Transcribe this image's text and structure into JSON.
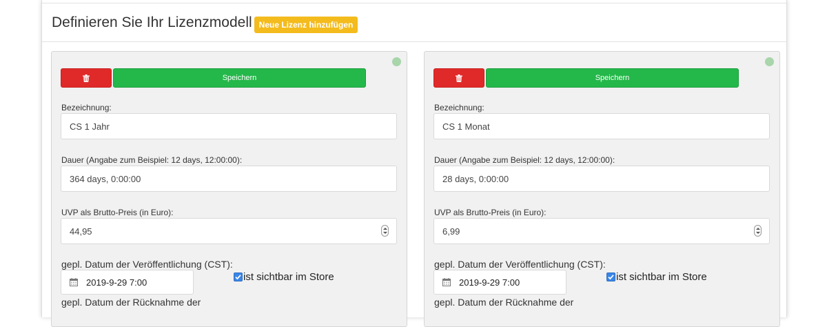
{
  "header": {
    "title": "Definieren Sie Ihr Lizenzmodell",
    "add_button": "Neue Lizenz hinzufügen"
  },
  "colors": {
    "accent_yellow": "#f4bb1c",
    "delete_red": "#e02a2a",
    "save_green": "#24b84a",
    "status_green": "#a8d5aa"
  },
  "licenses": [
    {
      "save_label": "Speichern",
      "name_label": "Bezeichnung:",
      "name_value": "CS 1 Jahr",
      "duration_label": "Dauer (Angabe zum Beispiel: 12 days, 12:00:00):",
      "duration_value": "364 days, 0:00:00",
      "price_label": "UVP als Brutto-Preis (in Euro):",
      "price_value": "44,95",
      "publish_label": "gepl. Datum der Veröffentlichung (CST):",
      "publish_value": "2019-9-29 7:00",
      "visible_label": "ist sichtbar im Store",
      "withdraw_label": "gepl. Datum der Rücknahme der"
    },
    {
      "save_label": "Speichern",
      "name_label": "Bezeichnung:",
      "name_value": "CS 1 Monat",
      "duration_label": "Dauer (Angabe zum Beispiel: 12 days, 12:00:00):",
      "duration_value": "28 days, 0:00:00",
      "price_label": "UVP als Brutto-Preis (in Euro):",
      "price_value": "6,99",
      "publish_label": "gepl. Datum der Veröffentlichung (CST):",
      "publish_value": "2019-9-29 7:00",
      "visible_label": "ist sichtbar im Store",
      "withdraw_label": "gepl. Datum der Rücknahme der"
    }
  ]
}
